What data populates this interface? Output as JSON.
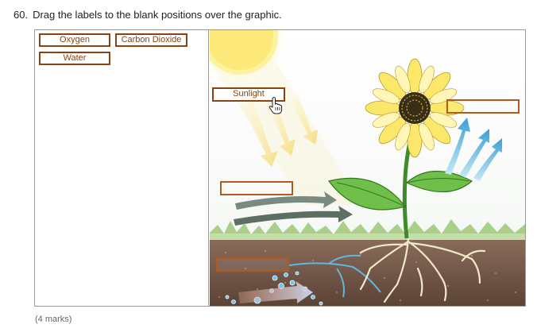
{
  "question": {
    "number": "60.",
    "text": "Drag the labels to the blank positions over the graphic."
  },
  "labels": {
    "oxygen": "Oxygen",
    "carbon_dioxide": "Carbon Dioxide",
    "water": "Water",
    "sunlight": "Sunlight"
  },
  "marks": "(4 marks)"
}
